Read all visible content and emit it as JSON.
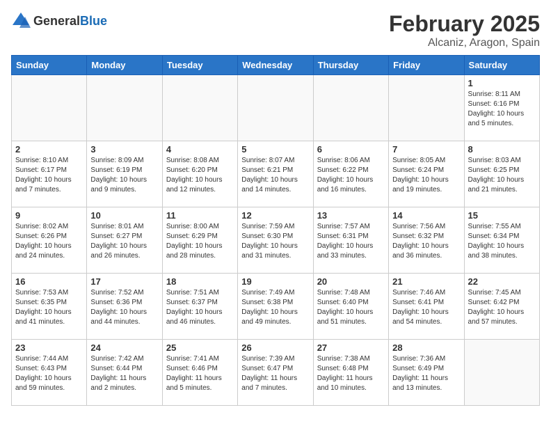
{
  "header": {
    "logo_general": "General",
    "logo_blue": "Blue",
    "month_title": "February 2025",
    "location": "Alcaniz, Aragon, Spain"
  },
  "weekdays": [
    "Sunday",
    "Monday",
    "Tuesday",
    "Wednesday",
    "Thursday",
    "Friday",
    "Saturday"
  ],
  "weeks": [
    [
      {
        "day": "",
        "info": ""
      },
      {
        "day": "",
        "info": ""
      },
      {
        "day": "",
        "info": ""
      },
      {
        "day": "",
        "info": ""
      },
      {
        "day": "",
        "info": ""
      },
      {
        "day": "",
        "info": ""
      },
      {
        "day": "1",
        "info": "Sunrise: 8:11 AM\nSunset: 6:16 PM\nDaylight: 10 hours and 5 minutes."
      }
    ],
    [
      {
        "day": "2",
        "info": "Sunrise: 8:10 AM\nSunset: 6:17 PM\nDaylight: 10 hours and 7 minutes."
      },
      {
        "day": "3",
        "info": "Sunrise: 8:09 AM\nSunset: 6:19 PM\nDaylight: 10 hours and 9 minutes."
      },
      {
        "day": "4",
        "info": "Sunrise: 8:08 AM\nSunset: 6:20 PM\nDaylight: 10 hours and 12 minutes."
      },
      {
        "day": "5",
        "info": "Sunrise: 8:07 AM\nSunset: 6:21 PM\nDaylight: 10 hours and 14 minutes."
      },
      {
        "day": "6",
        "info": "Sunrise: 8:06 AM\nSunset: 6:22 PM\nDaylight: 10 hours and 16 minutes."
      },
      {
        "day": "7",
        "info": "Sunrise: 8:05 AM\nSunset: 6:24 PM\nDaylight: 10 hours and 19 minutes."
      },
      {
        "day": "8",
        "info": "Sunrise: 8:03 AM\nSunset: 6:25 PM\nDaylight: 10 hours and 21 minutes."
      }
    ],
    [
      {
        "day": "9",
        "info": "Sunrise: 8:02 AM\nSunset: 6:26 PM\nDaylight: 10 hours and 24 minutes."
      },
      {
        "day": "10",
        "info": "Sunrise: 8:01 AM\nSunset: 6:27 PM\nDaylight: 10 hours and 26 minutes."
      },
      {
        "day": "11",
        "info": "Sunrise: 8:00 AM\nSunset: 6:29 PM\nDaylight: 10 hours and 28 minutes."
      },
      {
        "day": "12",
        "info": "Sunrise: 7:59 AM\nSunset: 6:30 PM\nDaylight: 10 hours and 31 minutes."
      },
      {
        "day": "13",
        "info": "Sunrise: 7:57 AM\nSunset: 6:31 PM\nDaylight: 10 hours and 33 minutes."
      },
      {
        "day": "14",
        "info": "Sunrise: 7:56 AM\nSunset: 6:32 PM\nDaylight: 10 hours and 36 minutes."
      },
      {
        "day": "15",
        "info": "Sunrise: 7:55 AM\nSunset: 6:34 PM\nDaylight: 10 hours and 38 minutes."
      }
    ],
    [
      {
        "day": "16",
        "info": "Sunrise: 7:53 AM\nSunset: 6:35 PM\nDaylight: 10 hours and 41 minutes."
      },
      {
        "day": "17",
        "info": "Sunrise: 7:52 AM\nSunset: 6:36 PM\nDaylight: 10 hours and 44 minutes."
      },
      {
        "day": "18",
        "info": "Sunrise: 7:51 AM\nSunset: 6:37 PM\nDaylight: 10 hours and 46 minutes."
      },
      {
        "day": "19",
        "info": "Sunrise: 7:49 AM\nSunset: 6:38 PM\nDaylight: 10 hours and 49 minutes."
      },
      {
        "day": "20",
        "info": "Sunrise: 7:48 AM\nSunset: 6:40 PM\nDaylight: 10 hours and 51 minutes."
      },
      {
        "day": "21",
        "info": "Sunrise: 7:46 AM\nSunset: 6:41 PM\nDaylight: 10 hours and 54 minutes."
      },
      {
        "day": "22",
        "info": "Sunrise: 7:45 AM\nSunset: 6:42 PM\nDaylight: 10 hours and 57 minutes."
      }
    ],
    [
      {
        "day": "23",
        "info": "Sunrise: 7:44 AM\nSunset: 6:43 PM\nDaylight: 10 hours and 59 minutes."
      },
      {
        "day": "24",
        "info": "Sunrise: 7:42 AM\nSunset: 6:44 PM\nDaylight: 11 hours and 2 minutes."
      },
      {
        "day": "25",
        "info": "Sunrise: 7:41 AM\nSunset: 6:46 PM\nDaylight: 11 hours and 5 minutes."
      },
      {
        "day": "26",
        "info": "Sunrise: 7:39 AM\nSunset: 6:47 PM\nDaylight: 11 hours and 7 minutes."
      },
      {
        "day": "27",
        "info": "Sunrise: 7:38 AM\nSunset: 6:48 PM\nDaylight: 11 hours and 10 minutes."
      },
      {
        "day": "28",
        "info": "Sunrise: 7:36 AM\nSunset: 6:49 PM\nDaylight: 11 hours and 13 minutes."
      },
      {
        "day": "",
        "info": ""
      }
    ]
  ]
}
